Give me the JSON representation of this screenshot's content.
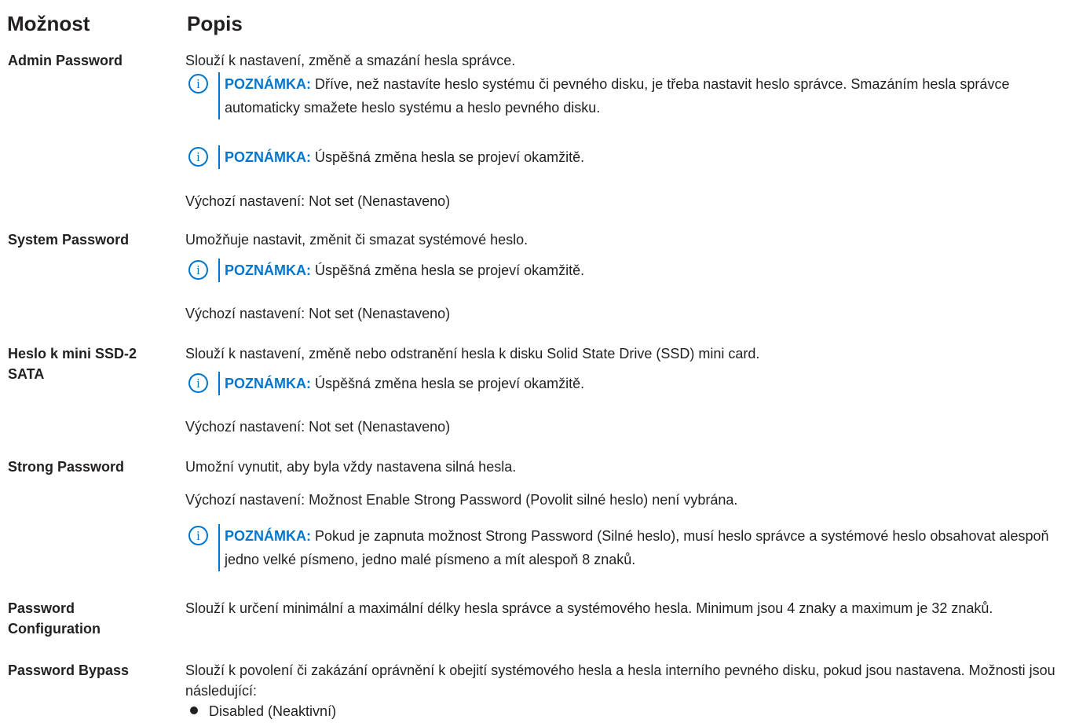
{
  "header": {
    "option": "Možnost",
    "description": "Popis"
  },
  "note_label": "POZNÁMKA:",
  "rows": [
    {
      "option": "Admin Password",
      "description": "Slouží k nastavení, změně a smazání hesla správce.",
      "note1": "Dříve, než nastavíte heslo systému či pevného disku, je třeba nastavit heslo správce. Smazáním hesla správce automaticky smažete heslo systému a heslo pevného disku.",
      "note2": "Úspěšná změna hesla se projeví okamžitě.",
      "default": "Výchozí nastavení: Not set (Nenastaveno)"
    },
    {
      "option": "System Password",
      "description": "Umožňuje nastavit, změnit či smazat systémové heslo.",
      "note1": "Úspěšná změna hesla se projeví okamžitě.",
      "default": "Výchozí nastavení: Not set (Nenastaveno)"
    },
    {
      "option": "Heslo k mini SSD-2 SATA",
      "description": "Slouží k nastavení, změně nebo odstranění hesla k disku Solid State Drive (SSD) mini card.",
      "note1": "Úspěšná změna hesla se projeví okamžitě.",
      "default": "Výchozí nastavení: Not set (Nenastaveno)"
    },
    {
      "option": "Strong Password",
      "description": "Umožní vynutit, aby byla vždy nastavena silná hesla.",
      "default": "Výchozí nastavení: Možnost Enable Strong Password (Povolit silné heslo) není vybrána.",
      "note1": "Pokud je zapnuta možnost Strong Password (Silné heslo), musí heslo správce a systémové heslo obsahovat alespoň jedno velké písmeno, jedno malé písmeno a mít alespoň 8 znaků."
    },
    {
      "option": "Password Configuration",
      "description": "Slouží k určení minimální a maximální délky hesla správce a systémového hesla. Minimum jsou 4 znaky a maximum je 32 znaků."
    },
    {
      "option": "Password Bypass",
      "description": "Slouží k povolení či zakázání oprávnění k obejití systémového hesla a hesla interního pevného disku, pokud jsou nastavena. Možnosti jsou následující:",
      "bullets": [
        "Disabled (Neaktivní)"
      ]
    }
  ]
}
